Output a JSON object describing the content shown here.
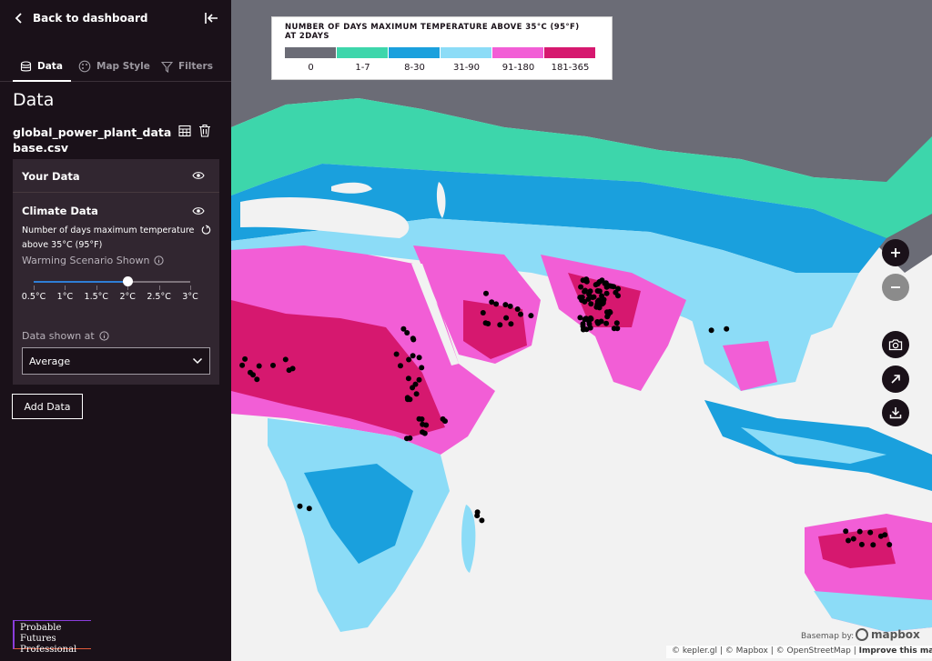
{
  "sidebar": {
    "back_label": "Back to dashboard",
    "tabs": [
      "Data",
      "Map Style",
      "Filters"
    ],
    "section_title": "Data",
    "dataset_name": "global_power_plant_database.csv",
    "your_data_label": "Your Data",
    "climate_data_label": "Climate Data",
    "climate_description": "Number of days maximum temperature above 35°C (95°F)",
    "scenario_label": "Warming Scenario Shown",
    "scenario_ticks": [
      "0.5°C",
      "1°C",
      "1.5°C",
      "2°C",
      "2.5°C",
      "3°C"
    ],
    "scenario_selected": "2°C",
    "scenario_selected_index": 3,
    "data_shown_label": "Data shown at",
    "data_shown_value": "Average",
    "add_data_label": "Add Data",
    "logo_line1": "Probable Futures",
    "logo_line2": "Professional"
  },
  "legend": {
    "title": "NUMBER OF DAYS MAXIMUM TEMPERATURE ABOVE 35°C (95°F) AT 2DAYS",
    "bins": [
      {
        "label": "0",
        "color": "#6b6c76"
      },
      {
        "label": "1-7",
        "color": "#3dd6ab"
      },
      {
        "label": "8-30",
        "color": "#1aa0dd"
      },
      {
        "label": "31-90",
        "color": "#8cdcf7"
      },
      {
        "label": "91-180",
        "color": "#f25ed6"
      },
      {
        "label": "181-365",
        "color": "#d6186f"
      }
    ]
  },
  "map": {
    "basemap_label": "Basemap by:",
    "mapbox_label": "mapbox",
    "attribution": "© kepler.gl | © Mapbox | © OpenStreetMap |",
    "improve_label": "Improve this map",
    "land_background": "#f2f2f2",
    "point_color": "#000000",
    "controls": [
      "zoom-in-icon",
      "zoom-out-icon",
      "camera-icon",
      "expand-icon",
      "download-icon"
    ]
  }
}
